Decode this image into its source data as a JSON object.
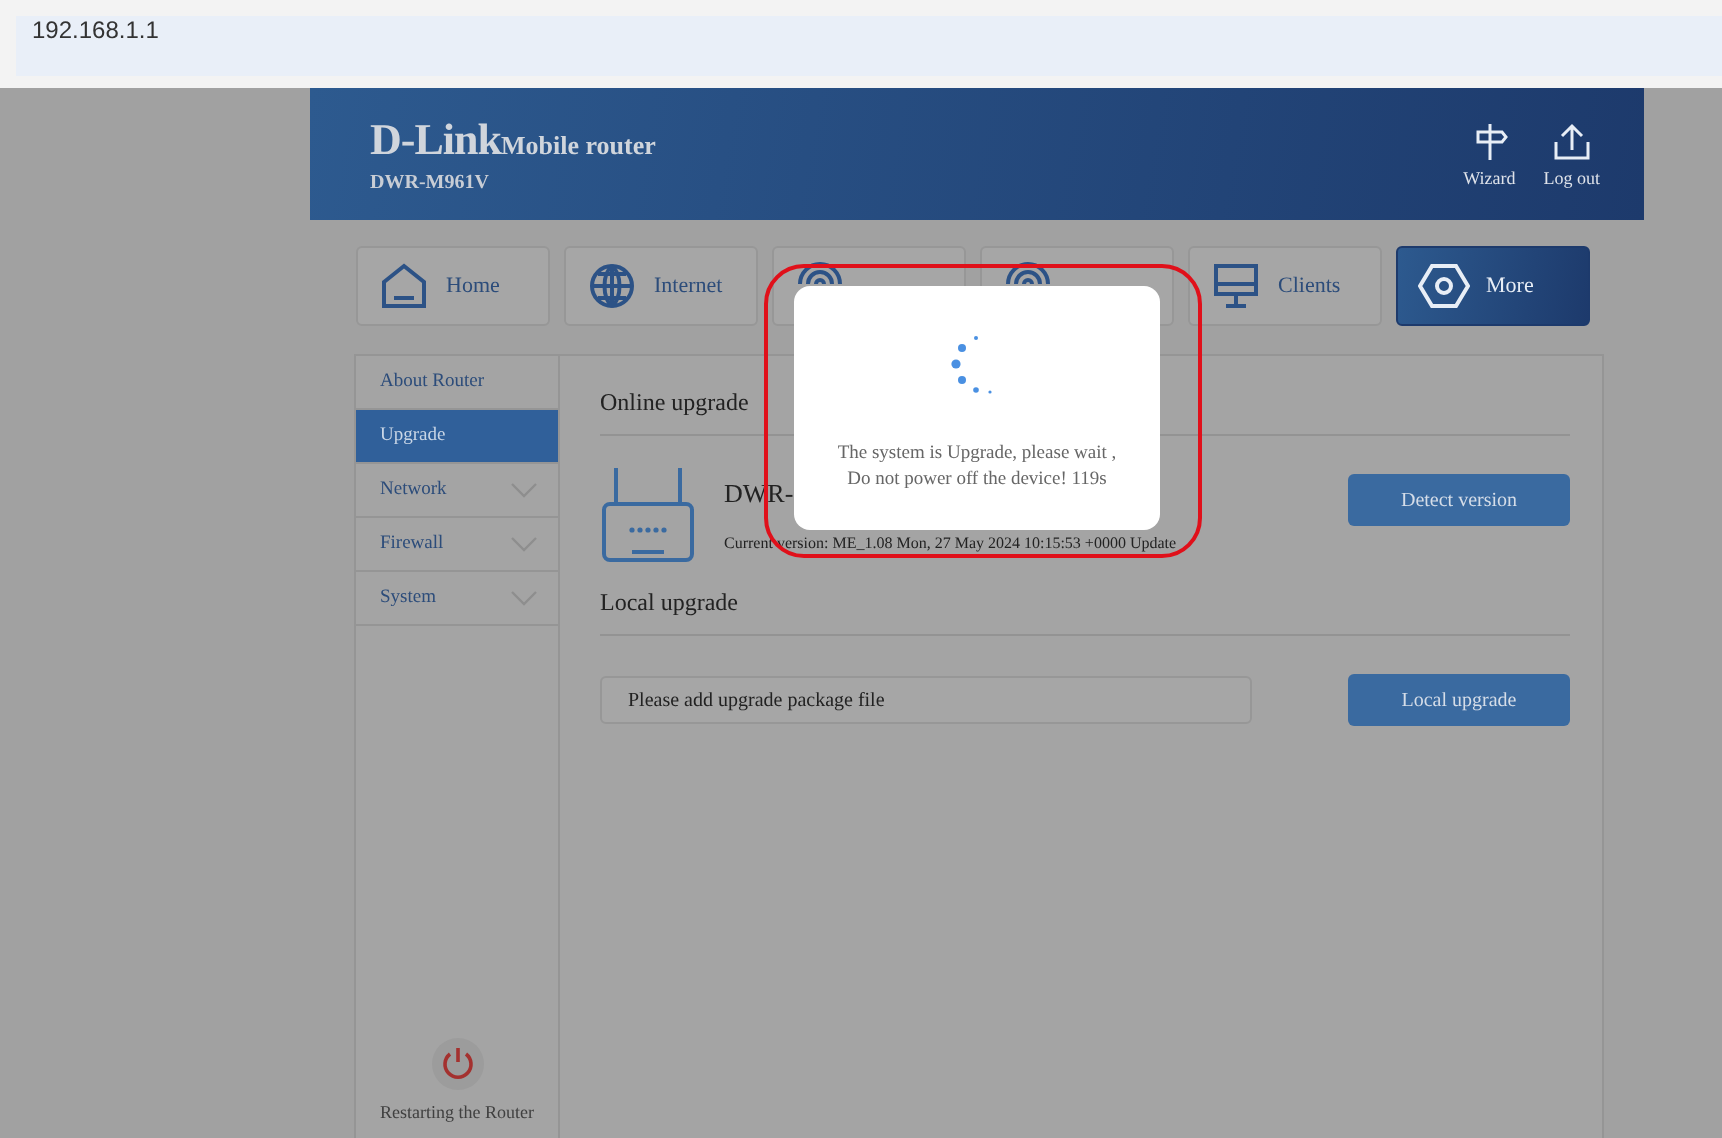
{
  "address_bar": {
    "url": "192.168.1.1"
  },
  "header": {
    "logo": "D-Link",
    "product": "Mobile router",
    "model": "DWR-M961V",
    "actions": [
      {
        "kind": "signpost",
        "label": "Wizard"
      },
      {
        "kind": "logout",
        "label": "Log out"
      }
    ]
  },
  "tabs": [
    {
      "kind": "home",
      "label": "Home",
      "selected": false
    },
    {
      "kind": "globe",
      "label": "Internet",
      "selected": false
    },
    {
      "kind": "rings",
      "selected": false
    },
    {
      "kind": "rings",
      "selected": false
    },
    {
      "kind": "monitor",
      "label": "Clients",
      "selected": false
    },
    {
      "kind": "hexagon",
      "label": "More",
      "selected": true
    }
  ],
  "sidebar": {
    "items": [
      {
        "label": "About Router",
        "has_submenu": false,
        "selected": false
      },
      {
        "label": "Upgrade",
        "has_submenu": false,
        "selected": true
      },
      {
        "label": "Network",
        "has_submenu": true,
        "selected": false
      },
      {
        "label": "Firewall",
        "has_submenu": true,
        "selected": false
      },
      {
        "label": "System",
        "has_submenu": true,
        "selected": false
      }
    ],
    "restart_label": "Restarting the Router"
  },
  "online_upgrade": {
    "title": "Online upgrade",
    "device_name": "DWR-",
    "current_version": "Current version: ME_1.08 Mon, 27 May 2024 10:15:53 +0000 Update",
    "button": "Detect version"
  },
  "local_upgrade": {
    "title": "Local upgrade",
    "placeholder": "Please add upgrade package file",
    "button": "Local upgrade"
  },
  "modal": {
    "lines": [
      "The system is Upgrade, please wait ,",
      "Do not power off the device! 119s"
    ]
  }
}
